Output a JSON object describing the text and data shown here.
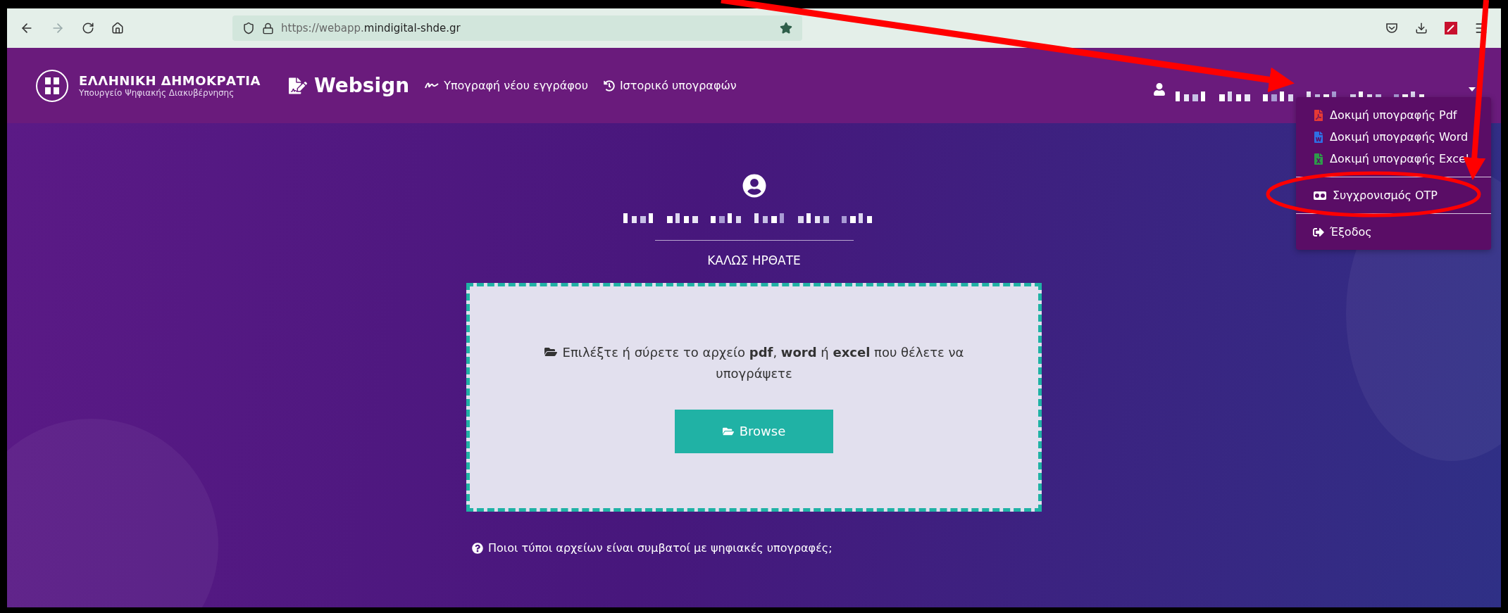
{
  "browser": {
    "url_scheme": "https://webapp.",
    "url_host": "mindigital-shde.gr"
  },
  "header": {
    "org_title": "ΕΛΛΗΝΙΚΗ ΔΗΜΟΚΡΑΤΙΑ",
    "org_subtitle": "Υπουργείο Ψηφιακής Διακυβέρνησης",
    "brand": "Websign",
    "nav": [
      {
        "kind": "sign",
        "label": "Υπογραφή νέου εγγράφου"
      },
      {
        "kind": "history",
        "label": "Ιστορικό υπογραφών"
      }
    ]
  },
  "user_menu": {
    "expanded": true,
    "items": [
      {
        "kind": "pdf",
        "label": "Δοκιμή υπογραφής Pdf",
        "divider_before": false
      },
      {
        "kind": "word",
        "label": "Δοκιμή υπογραφής Word",
        "divider_before": false
      },
      {
        "kind": "excel",
        "label": "Δοκιμή υπογραφής Excel",
        "divider_before": false
      },
      {
        "kind": "otp",
        "label": "Συγχρονισμός OTP",
        "divider_before": true
      },
      {
        "kind": "logout",
        "label": "Έξοδος",
        "divider_before": true
      }
    ]
  },
  "welcome": "ΚΑΛΩΣ ΗΡΘΑΤΕ",
  "dropzone": {
    "text": "Επιλέξτε ή σύρετε το αρχείο **pdf**, **word** ή **excel** που θέλετε να υπογράψετε",
    "button": "Browse"
  },
  "help_link": "Ποιοι τύποι αρχείων είναι συμβατοί με ψηφιακές υπογραφές;"
}
